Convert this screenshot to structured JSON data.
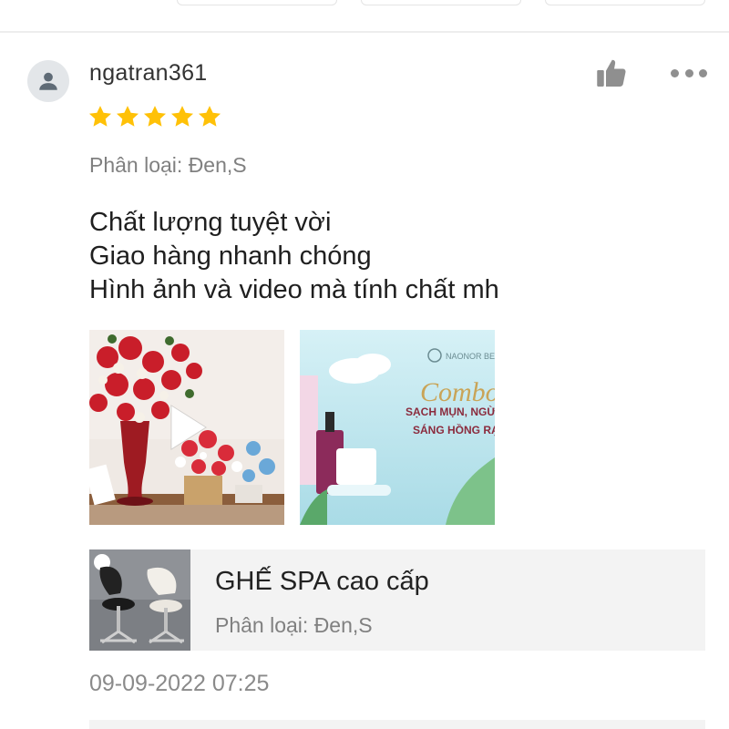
{
  "review": {
    "username": "ngatran361",
    "rating": 5,
    "variant_label": "Phân loại: Đen,S",
    "text_lines": [
      "Chất lượng tuyệt vời",
      "Giao hàng nhanh chóng",
      "Hình ảnh và video mà tính chất mh"
    ],
    "media": [
      {
        "type": "video",
        "icon": "play-icon"
      },
      {
        "type": "image",
        "overlay_texts": [
          "Combo",
          "SẠCH MỤN, NGỪA",
          "SÁNG HỒNG RẠNG"
        ]
      }
    ],
    "timestamp": "09-09-2022 07:25"
  },
  "product": {
    "name": "GHẾ SPA cao cấp",
    "variant_label": "Phân loại: Đen,S"
  },
  "icons": {
    "avatar": "user-icon",
    "like": "thumbs-up-icon",
    "more": "more-horizontal-icon",
    "star": "star-icon",
    "play": "play-icon"
  },
  "colors": {
    "star": "#ffc107",
    "icon_gray": "#8f8f8f",
    "secondary_text": "#808080",
    "card_bg": "#f3f3f3"
  }
}
